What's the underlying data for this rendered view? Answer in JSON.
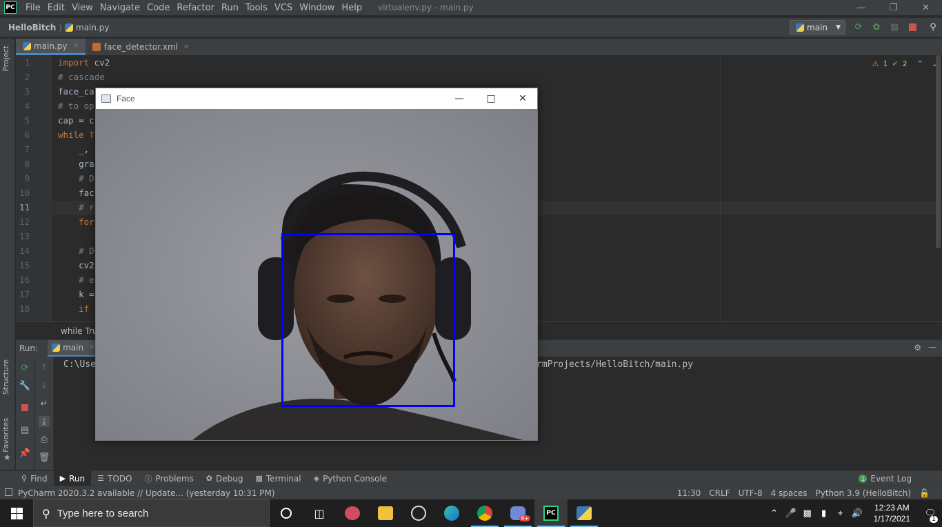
{
  "app": {
    "logo_text": "PC",
    "menu": [
      "File",
      "Edit",
      "View",
      "Navigate",
      "Code",
      "Refactor",
      "Run",
      "Tools",
      "VCS",
      "Window",
      "Help"
    ],
    "window_title": "virtualenv.py - main.py"
  },
  "navbar": {
    "project": "HelloBitch",
    "file": "main.py",
    "run_config": "main"
  },
  "left_strip": {
    "top": "Project",
    "mid": "Structure",
    "bottom": "Favorites"
  },
  "tabs": [
    {
      "label": "main.py",
      "active": true
    },
    {
      "label": "face_detector.xml",
      "active": false
    }
  ],
  "editor": {
    "inspection": {
      "warnings": "1",
      "ok": "2"
    },
    "lines": [
      {
        "n": "1",
        "text": "import cv2"
      },
      {
        "n": "2",
        "text": "# cascade"
      },
      {
        "n": "3",
        "text": "face_ca"
      },
      {
        "n": "4",
        "text": "# to op"
      },
      {
        "n": "5",
        "text": "cap = c"
      },
      {
        "n": "6",
        "text": "while T"
      },
      {
        "n": "7",
        "text": "    _,"
      },
      {
        "n": "8",
        "text": "    gra"
      },
      {
        "n": "9",
        "text": "    # D"
      },
      {
        "n": "10",
        "text": "    fac"
      },
      {
        "n": "11",
        "text": "    # r"
      },
      {
        "n": "12",
        "text": "    for"
      },
      {
        "n": "13",
        "text": ""
      },
      {
        "n": "14",
        "text": "    # D"
      },
      {
        "n": "15",
        "text": "    cv2"
      },
      {
        "n": "16",
        "text": "    # e"
      },
      {
        "n": "17",
        "text": "    k ="
      },
      {
        "n": "18",
        "text": "    if"
      }
    ],
    "breadcrumb": "while True"
  },
  "run": {
    "label": "Run:",
    "tab": "main",
    "console_left": "C:\\Use",
    "console_right": "rmProjects/HelloBitch/main.py"
  },
  "bottom_tabs": [
    "Find",
    "Run",
    "TODO",
    "Problems",
    "Debug",
    "Terminal",
    "Python Console"
  ],
  "event_log": {
    "count": "1",
    "label": "Event Log"
  },
  "status": {
    "message": "PyCharm 2020.3.2 available // Update... (yesterday 10:31 PM)",
    "position": "11:30",
    "line_sep": "CRLF",
    "encoding": "UTF-8",
    "indent": "4 spaces",
    "interpreter": "Python 3.9 (HelloBitch)"
  },
  "face_window": {
    "title": "Face",
    "detection_color": "#0000ff"
  },
  "taskbar": {
    "search_placeholder": "Type here to search",
    "time": "12:23 AM",
    "date": "1/17/2021",
    "notification_count": "1",
    "discord_badge": "9+"
  }
}
